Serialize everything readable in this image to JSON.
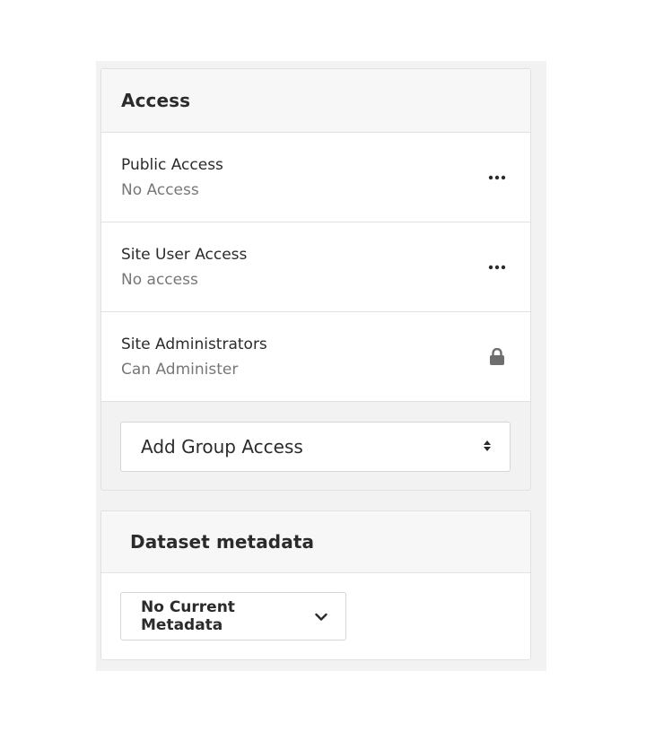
{
  "access": {
    "title": "Access",
    "rows": [
      {
        "title": "Public Access",
        "subtitle": "No Access",
        "action_icon": "more-horizontal-icon"
      },
      {
        "title": "Site User Access",
        "subtitle": "No access",
        "action_icon": "more-horizontal-icon"
      },
      {
        "title": "Site Administrators",
        "subtitle": "Can Administer",
        "action_icon": "lock-icon"
      }
    ],
    "add_group": {
      "label": "Add Group Access",
      "icon": "sort-arrows-icon"
    }
  },
  "metadata": {
    "title": "Dataset metadata",
    "select": {
      "label": "No Current Metadata",
      "icon": "chevron-down-icon"
    }
  },
  "colors": {
    "text_primary": "#2b2b2b",
    "text_secondary": "#777777",
    "panel_bg": "#f2f2f2",
    "border": "#e1e1e1"
  }
}
